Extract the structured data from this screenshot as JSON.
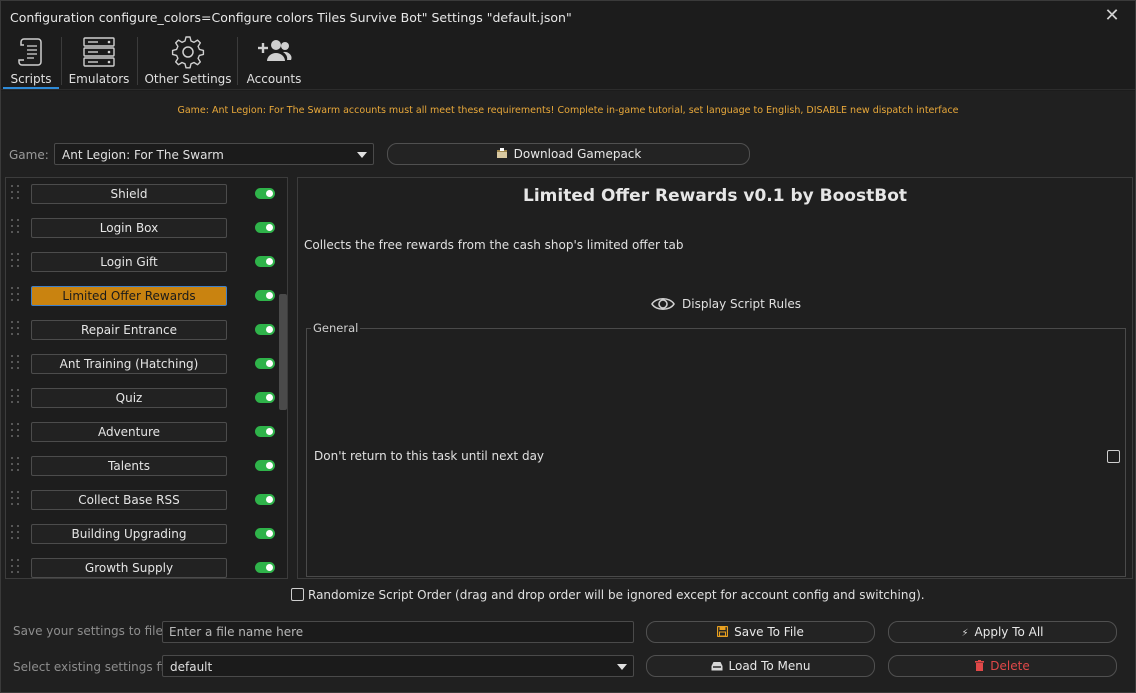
{
  "window": {
    "title": "Configuration configure_colors=Configure colors Tiles Survive Bot\" Settings \"default.json\"",
    "close_glyph": "✕"
  },
  "tabs": [
    {
      "label": "Scripts",
      "icon": "scroll-icon",
      "active": true
    },
    {
      "label": "Emulators",
      "icon": "server-icon",
      "active": false
    },
    {
      "label": "Other Settings",
      "icon": "gear-icon",
      "active": false
    },
    {
      "label": "Accounts",
      "icon": "add-users-icon",
      "active": false
    }
  ],
  "notice": "Game: Ant Legion: For The Swarm accounts must all meet these requirements! Complete in-game tutorial, set language to English, DISABLE new dispatch interface",
  "game": {
    "label": "Game:",
    "selected": "Ant Legion: For The Swarm",
    "download_label": "Download Gamepack",
    "download_icon": "download-box-icon"
  },
  "scripts": [
    {
      "label": "Shield",
      "enabled": true,
      "selected": false
    },
    {
      "label": "Login Box",
      "enabled": true,
      "selected": false
    },
    {
      "label": "Login Gift",
      "enabled": true,
      "selected": false
    },
    {
      "label": "Limited Offer Rewards",
      "enabled": true,
      "selected": true
    },
    {
      "label": "Repair Entrance",
      "enabled": true,
      "selected": false
    },
    {
      "label": "Ant Training (Hatching)",
      "enabled": true,
      "selected": false
    },
    {
      "label": "Quiz",
      "enabled": true,
      "selected": false
    },
    {
      "label": "Adventure",
      "enabled": true,
      "selected": false
    },
    {
      "label": "Talents",
      "enabled": true,
      "selected": false
    },
    {
      "label": "Collect Base RSS",
      "enabled": true,
      "selected": false
    },
    {
      "label": "Building Upgrading",
      "enabled": true,
      "selected": false
    },
    {
      "label": "Growth Supply",
      "enabled": true,
      "selected": false
    }
  ],
  "detail": {
    "title": "Limited Offer Rewards v0.1 by BoostBot",
    "description": "Collects the free rewards from the cash shop's limited offer tab",
    "rules_label": "Display Script Rules",
    "group_label": "General",
    "option_label": "Don't return to this task until next day",
    "option_checked": false
  },
  "randomize": {
    "label": "Randomize Script Order (drag and drop order will be ignored except for account config and switching).",
    "checked": false
  },
  "save": {
    "label": "Save your settings to file",
    "placeholder": "Enter a file name here",
    "save_button": "Save To File",
    "apply_button": "Apply To All"
  },
  "load": {
    "label": "Select existing settings file",
    "selected": "default",
    "load_button": "Load To Menu",
    "delete_button": "Delete"
  },
  "colors": {
    "accent": "#2e8bd8",
    "notice": "#e8a83a",
    "selected_script": "#c98310",
    "toggle_on": "#2fb34a",
    "save_icon": "#e8a020",
    "delete_text": "#e04848"
  }
}
